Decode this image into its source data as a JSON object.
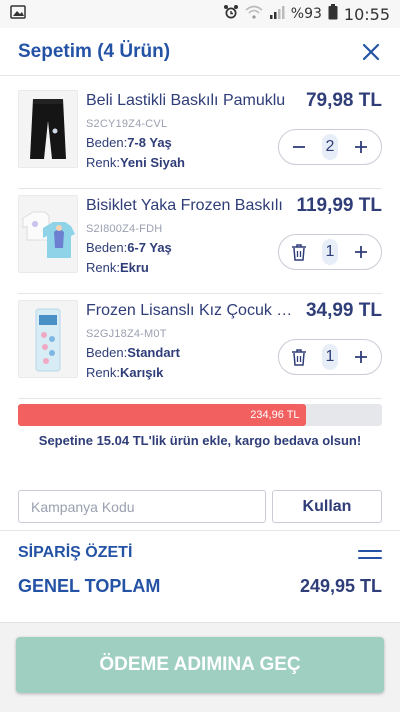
{
  "status_bar": {
    "battery": "%93",
    "time": "10:55"
  },
  "header": {
    "title": "Sepetim (4 Ürün)"
  },
  "items": [
    {
      "name": "Beli Lastikli Baskılı Pamuklu",
      "price": "79,98 TL",
      "sku": "S2CY19Z4-CVL",
      "beden_label": "Beden:",
      "beden": "7-8 Yaş",
      "renk_label": "Renk:",
      "renk": "Yeni Siyah",
      "quantity": "2",
      "left_control": "minus"
    },
    {
      "name": "Bisiklet Yaka Frozen Baskılı",
      "price": "119,99 TL",
      "sku": "S2I800Z4-FDH",
      "beden_label": "Beden:",
      "beden": "6-7 Yaş",
      "renk_label": "Renk:",
      "renk": "Ekru",
      "quantity": "1",
      "left_control": "trash"
    },
    {
      "name": "Frozen Lisanslı Kız Çocuk Saç",
      "price": "34,99 TL",
      "sku": "S2GJ18Z4-M0T",
      "beden_label": "Beden:",
      "beden": "Standart",
      "renk_label": "Renk:",
      "renk": "Karışık",
      "quantity": "1",
      "left_control": "trash"
    }
  ],
  "shipping": {
    "current_total": "234,96 TL",
    "progress_percent": 79,
    "message": "Sepetine 15.04 TL'lik ürün ekle, kargo bedava olsun!"
  },
  "coupon": {
    "placeholder": "Kampanya Kodu",
    "apply_label": "Kullan"
  },
  "summary": {
    "title": "SİPARİŞ ÖZETİ",
    "total_label": "GENEL TOPLAM",
    "total_value": "249,95 TL"
  },
  "checkout": {
    "label": "ÖDEME ADIMINA GEÇ"
  },
  "colors": {
    "brand": "#2453a5",
    "text": "#2f3d78",
    "progress": "#f26060",
    "checkout": "#9fcfc1"
  }
}
